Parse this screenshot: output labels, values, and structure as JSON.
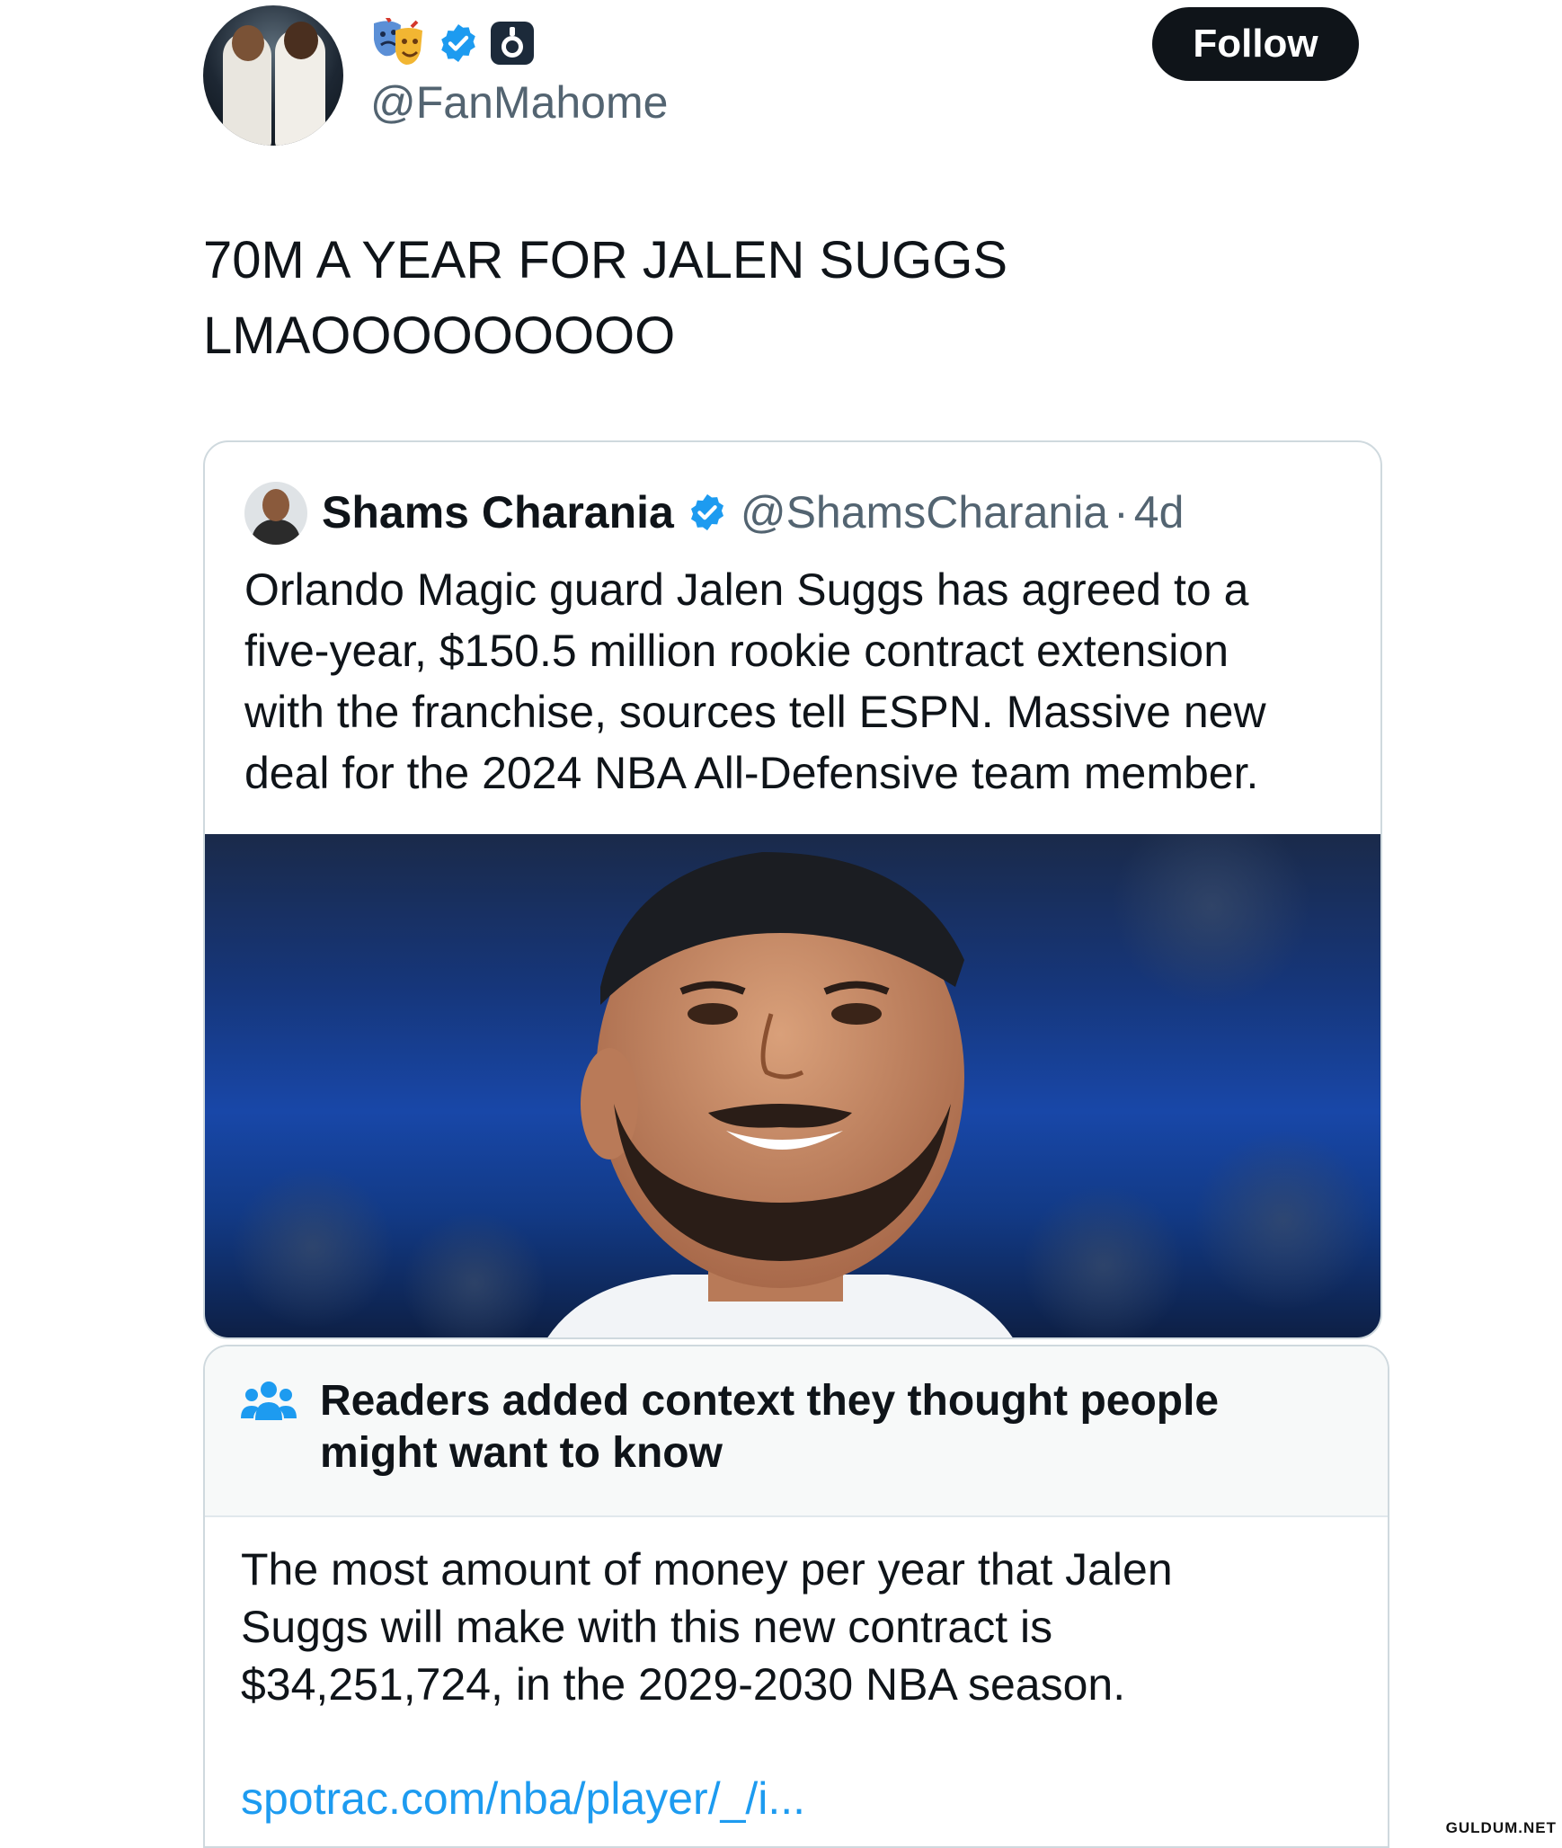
{
  "author": {
    "handle": "@FanMahome",
    "badges": [
      "theater-masks-icon",
      "verified-badge-icon",
      "app-icon"
    ]
  },
  "follow_button": {
    "label": "Follow"
  },
  "tweet": {
    "lines": [
      "70M A YEAR FOR JALEN SUGGS",
      "LMAOOOOOOOOO"
    ]
  },
  "quoted_tweet": {
    "name": "Shams Charania",
    "handle": "@ShamsCharania",
    "separator": "·",
    "time": "4d",
    "lines": [
      "Orlando Magic guard Jalen Suggs has agreed to a",
      "five-year, $150.5 million rookie contract extension",
      "with the franchise, sources tell ESPN. Massive new",
      "deal for the 2024 NBA All-Defensive team member."
    ]
  },
  "community_note": {
    "title_lines": [
      "Readers added context they thought people",
      "might want to know"
    ],
    "body_lines": [
      "The most amount of money per year that Jalen",
      "Suggs will make with this new contract is",
      "$34,251,724, in the 2029-2030 NBA season."
    ],
    "link": "spotrac.com/nba/player/_/i..."
  },
  "watermark": "GULDUM.NET",
  "colors": {
    "text": "#0f1419",
    "secondary": "#536471",
    "link": "#1d9bf0",
    "verified": "#1d9bf0",
    "border": "#cfd9de"
  }
}
